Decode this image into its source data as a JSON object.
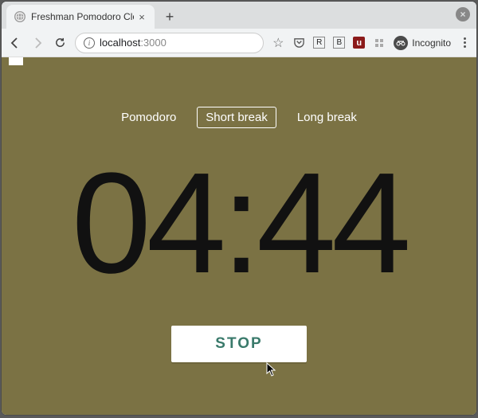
{
  "browser": {
    "tab_title": "Freshman Pomodoro Cloc",
    "url_host": "localhost",
    "url_port": ":3000",
    "incognito_label": "Incognito",
    "ublock_colors": {
      "bg": "#8b1a1a",
      "fg": "#fff"
    },
    "extension_letters": {
      "r": "R",
      "b": "B"
    }
  },
  "modes": {
    "pomodoro": "Pomodoro",
    "short_break": "Short break",
    "long_break": "Long break",
    "active": "short_break"
  },
  "timer": {
    "display": "04:44"
  },
  "action": {
    "label": "STOP"
  },
  "colors": {
    "page_bg": "#7b7244",
    "timer_text": "#111111",
    "button_text": "#3a7a6b"
  }
}
